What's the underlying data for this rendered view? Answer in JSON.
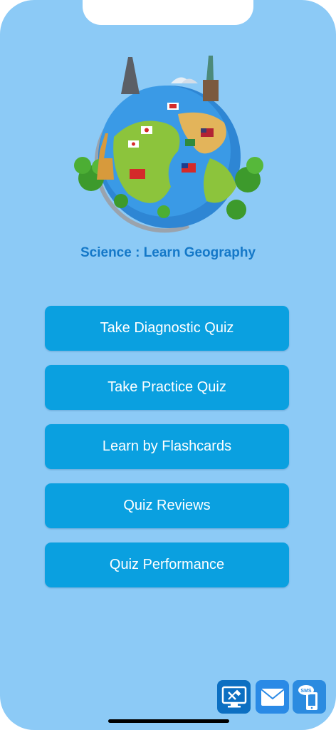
{
  "app": {
    "title": "Science : Learn Geography"
  },
  "menu": {
    "items": [
      {
        "label": "Take Diagnostic Quiz"
      },
      {
        "label": "Take Practice Quiz"
      },
      {
        "label": "Learn by Flashcards"
      },
      {
        "label": "Quiz Reviews"
      },
      {
        "label": "Quiz Performance"
      }
    ]
  },
  "dock": {
    "icons": [
      "support-icon",
      "mail-icon",
      "sms-icon"
    ],
    "sms_text": "SMS"
  },
  "colors": {
    "background": "#8ccaf6",
    "button": "#0aa0e0",
    "title": "#1478c8"
  }
}
